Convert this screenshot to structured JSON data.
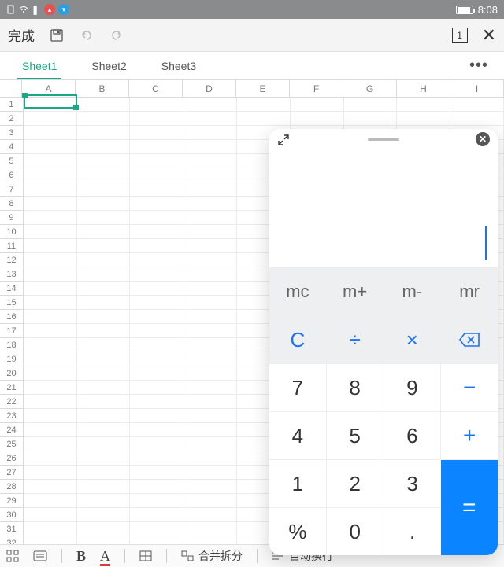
{
  "status": {
    "time": "8:08"
  },
  "appbar": {
    "done": "完成",
    "page": "1"
  },
  "tabs": {
    "items": [
      "Sheet1",
      "Sheet2",
      "Sheet3"
    ],
    "active_index": 0
  },
  "grid": {
    "columns": [
      "A",
      "B",
      "C",
      "D",
      "E",
      "F",
      "G",
      "H",
      "I"
    ],
    "row_count": 32,
    "selected_cell": "A2"
  },
  "toolbar": {
    "merge_split": "合并拆分",
    "wrap": "自动换行",
    "bold": "B",
    "font_color": "A"
  },
  "calc": {
    "display": "",
    "keys": {
      "mc": "mc",
      "mplus": "m+",
      "mminus": "m-",
      "mr": "mr",
      "clear": "C",
      "divide": "÷",
      "multiply": "×",
      "backspace": "⌫",
      "k7": "7",
      "k8": "8",
      "k9": "9",
      "minus": "−",
      "k4": "4",
      "k5": "5",
      "k6": "6",
      "plus": "+",
      "k1": "1",
      "k2": "2",
      "k3": "3",
      "percent": "%",
      "k0": "0",
      "dot": ".",
      "equals": "="
    }
  }
}
